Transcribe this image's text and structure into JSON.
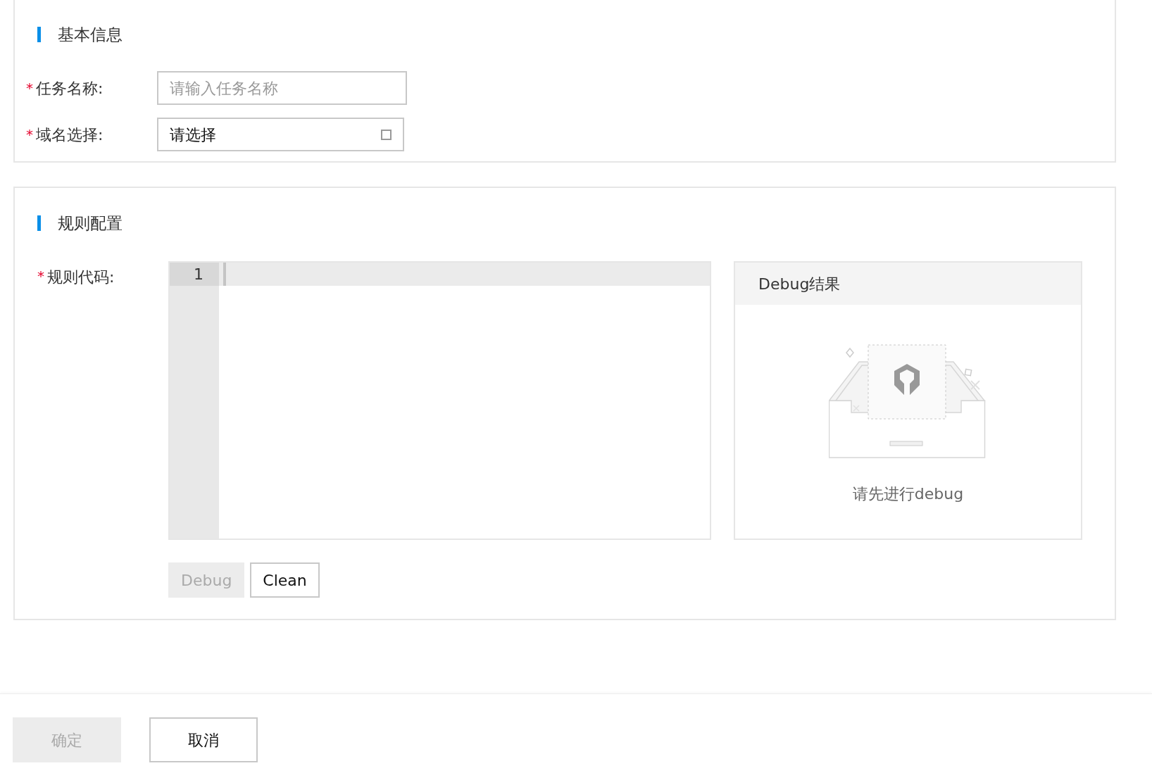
{
  "basic_info": {
    "title": "基本信息",
    "fields": [
      {
        "kind": "input",
        "required_mark": "*",
        "label": "任务名称:",
        "placeholder": "请输入任务名称"
      },
      {
        "kind": "select",
        "required_mark": "*",
        "label": "域名选择:",
        "value": "请选择"
      }
    ]
  },
  "rule_config": {
    "title": "规则配置",
    "code_label": "规则代码:",
    "code_required_mark": "*",
    "line_numbers": [
      "1"
    ],
    "debug_panel": {
      "title": "Debug结果",
      "empty_text": "请先进行debug"
    },
    "buttons": [
      {
        "label": "Debug",
        "disabled": true
      },
      {
        "label": "Clean",
        "disabled": false
      }
    ]
  },
  "footer": {
    "buttons": [
      {
        "label": "确定",
        "disabled": true
      },
      {
        "label": "取消",
        "disabled": false
      }
    ]
  }
}
